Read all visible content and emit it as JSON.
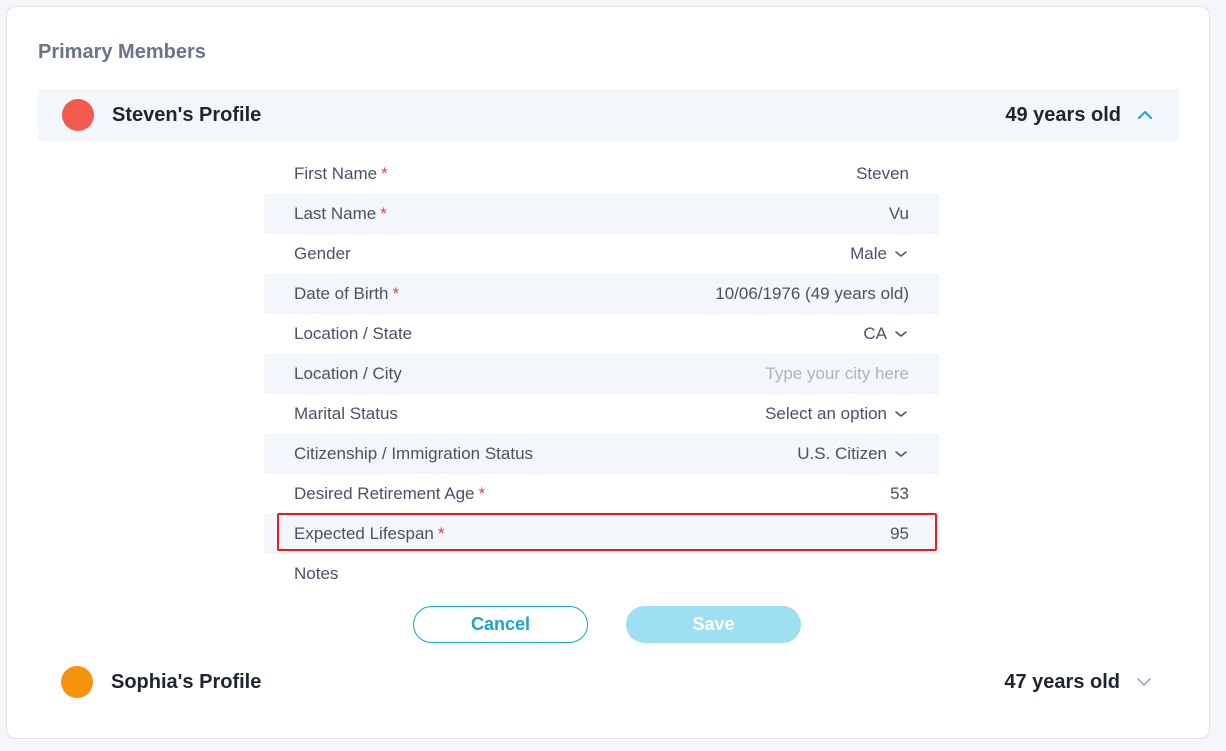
{
  "section_title": "Primary Members",
  "profiles": [
    {
      "name": "Steven's Profile",
      "age": "49 years old",
      "color": "#f25a4e",
      "expanded": true
    },
    {
      "name": "Sophia's Profile",
      "age": "47 years old",
      "color": "#f7930a",
      "expanded": false
    }
  ],
  "form": {
    "rows": [
      {
        "label": "First Name",
        "value": "Steven"
      },
      {
        "label": "Last Name",
        "value": "Vu"
      },
      {
        "label": "Gender",
        "value": "Male"
      },
      {
        "label": "Date of Birth",
        "value": "10/06/1976 (49 years old)"
      },
      {
        "label": "Location / State",
        "value": "CA"
      },
      {
        "label": "Location / City",
        "placeholder": "Type your city here"
      },
      {
        "label": "Marital Status",
        "value": "Select an option"
      },
      {
        "label": "Citizenship / Immigration Status",
        "value": "U.S. Citizen"
      },
      {
        "label": "Desired Retirement Age",
        "value": "53"
      },
      {
        "label": "Expected Lifespan",
        "value": "95"
      },
      {
        "label": "Notes",
        "value": ""
      }
    ],
    "required_mark": "*",
    "cancel_label": "Cancel",
    "save_label": "Save"
  },
  "colors": {
    "accent": "#1ba3c9",
    "required": "#e8454a",
    "highlight": "#e02020"
  },
  "icons": {
    "collapse": "chevron-up-icon",
    "expand": "chevron-down-icon",
    "dropdown": "chevron-down-icon"
  }
}
